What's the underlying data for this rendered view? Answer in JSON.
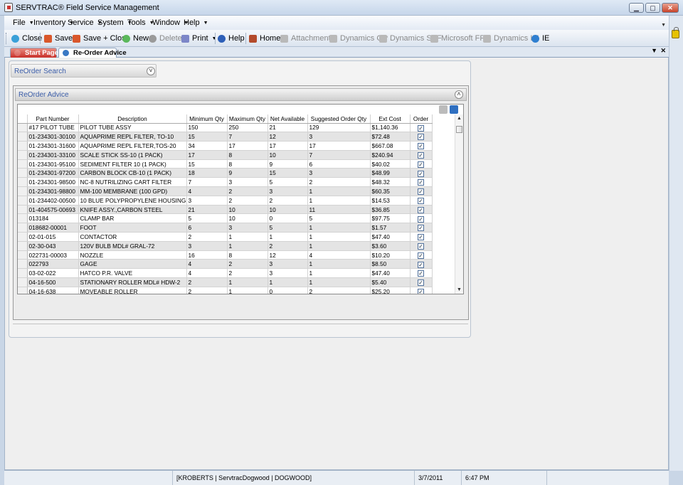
{
  "window": {
    "title": "SERVTRAC® Field Service Management",
    "controls": {
      "minimize": "▁",
      "maximize": "▢",
      "close": "✕"
    }
  },
  "menu": {
    "items": [
      {
        "label": "File"
      },
      {
        "label": "Inventory"
      },
      {
        "label": "Service"
      },
      {
        "label": "System"
      },
      {
        "label": "Tools"
      },
      {
        "label": "Window"
      },
      {
        "label": "Help"
      }
    ]
  },
  "toolbar": {
    "close": "Close",
    "save": "Save",
    "save_close": "Save + Close",
    "new": "New",
    "delete": "Delete",
    "print": "Print",
    "help": "Help",
    "home": "Home",
    "attachments": "Attachments",
    "dynamics_gp": "Dynamics GP",
    "dynamics_sbf": "Dynamics SBF",
    "microsoft_frx": "Microsoft FRX",
    "dynamics_im": "Dynamics IM",
    "ie": "IE"
  },
  "tabs": {
    "start_page": "Start Page",
    "reorder_advice": "Re-Order Advice",
    "menu_glyph": "▼",
    "close_glyph": "✕"
  },
  "search_panel": {
    "title": "ReOrder Search",
    "toggle": "˅"
  },
  "advice_panel": {
    "title": "ReOrder Advice",
    "toggle": "˄"
  },
  "grid": {
    "columns": [
      "Part Number",
      "Description",
      "Minimum Qty",
      "Maximum Qty",
      "Net Available",
      "Suggested Order Qty",
      "Ext Cost",
      "Order"
    ],
    "rows": [
      {
        "part": "#17 PILOT TUBE",
        "desc": "PILOT TUBE ASSY",
        "min": "150",
        "max": "250",
        "net": "21",
        "sugg": "129",
        "cost": "$1,140.36",
        "order": true
      },
      {
        "part": "01-234301-30100",
        "desc": "AQUAPRIME REPL FILTER, TO-10",
        "min": "15",
        "max": "7",
        "net": "12",
        "sugg": "3",
        "cost": "$72.48",
        "order": true
      },
      {
        "part": "01-234301-31600",
        "desc": "AQUAPRIME REPL FILTER,TOS-20",
        "min": "34",
        "max": "17",
        "net": "17",
        "sugg": "17",
        "cost": "$667.08",
        "order": true
      },
      {
        "part": "01-234301-33100",
        "desc": "SCALE STICK SS-10 (1 PACK)",
        "min": "17",
        "max": "8",
        "net": "10",
        "sugg": "7",
        "cost": "$240.94",
        "order": true
      },
      {
        "part": "01-234301-95100",
        "desc": "SEDIMENT FILTER 10 (1 PACK)",
        "min": "15",
        "max": "8",
        "net": "9",
        "sugg": "6",
        "cost": "$40.02",
        "order": true
      },
      {
        "part": "01-234301-97200",
        "desc": "CARBON BLOCK CB-10 (1 PACK)",
        "min": "18",
        "max": "9",
        "net": "15",
        "sugg": "3",
        "cost": "$48.99",
        "order": true
      },
      {
        "part": "01-234301-98500",
        "desc": "NC-8 NUTRILIZING CART FILTER",
        "min": "7",
        "max": "3",
        "net": "5",
        "sugg": "2",
        "cost": "$48.32",
        "order": true
      },
      {
        "part": "01-234301-98800",
        "desc": "MM-100 MEMBRANE (100 GPD)",
        "min": "4",
        "max": "2",
        "net": "3",
        "sugg": "1",
        "cost": "$60.35",
        "order": true
      },
      {
        "part": "01-234402-00500",
        "desc": "10 BLUE POLYPROPYLENE HOUSING",
        "min": "3",
        "max": "2",
        "net": "2",
        "sugg": "1",
        "cost": "$14.53",
        "order": true
      },
      {
        "part": "01-404575-00693",
        "desc": "KNIFE ASSY.,CARBON STEEL",
        "min": "21",
        "max": "10",
        "net": "10",
        "sugg": "11",
        "cost": "$36.85",
        "order": true
      },
      {
        "part": "013184",
        "desc": "CLAMP BAR",
        "min": "5",
        "max": "10",
        "net": "0",
        "sugg": "5",
        "cost": "$97.75",
        "order": true
      },
      {
        "part": "018682-00001",
        "desc": "FOOT",
        "min": "6",
        "max": "3",
        "net": "5",
        "sugg": "1",
        "cost": "$1.57",
        "order": true
      },
      {
        "part": "02-01-015",
        "desc": "CONTACTOR",
        "min": "2",
        "max": "1",
        "net": "1",
        "sugg": "1",
        "cost": "$47.40",
        "order": true
      },
      {
        "part": "02-30-043",
        "desc": "120V BULB          MDL# GRAL-72",
        "min": "3",
        "max": "1",
        "net": "2",
        "sugg": "1",
        "cost": "$3.60",
        "order": true
      },
      {
        "part": "022731-00003",
        "desc": "NOZZLE",
        "min": "16",
        "max": "8",
        "net": "12",
        "sugg": "4",
        "cost": "$10.20",
        "order": true
      },
      {
        "part": "022793",
        "desc": "GAGE",
        "min": "4",
        "max": "2",
        "net": "3",
        "sugg": "1",
        "cost": "$8.50",
        "order": true
      },
      {
        "part": "03-02-022",
        "desc": "HATCO P.R. VALVE",
        "min": "4",
        "max": "2",
        "net": "3",
        "sugg": "1",
        "cost": "$47.40",
        "order": true
      },
      {
        "part": "04-16-500",
        "desc": "STATIONARY ROLLER   MDL# HDW-2",
        "min": "2",
        "max": "1",
        "net": "1",
        "sugg": "1",
        "cost": "$5.40",
        "order": true
      },
      {
        "part": "04-16-638",
        "desc": "MOVEABLE ROLLER",
        "min": "2",
        "max": "1",
        "net": "0",
        "sugg": "2",
        "cost": "$25.20",
        "order": true
      }
    ]
  },
  "status": {
    "user": "[KROBERTS | ServtracDogwood | DOGWOOD]",
    "date": "3/7/2011",
    "time": "6:47 PM"
  }
}
